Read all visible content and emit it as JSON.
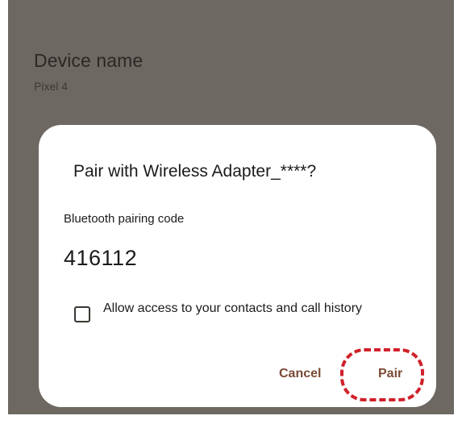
{
  "settings": {
    "device_name_title": "Device name",
    "device_name_value": "Pixel 4"
  },
  "dialog": {
    "title": "Pair with Wireless Adapter_****?",
    "code_label": "Bluetooth pairing code",
    "code_value": "416112",
    "access_checkbox_checked": false,
    "access_label": "Allow access to your contacts and call history",
    "cancel_label": "Cancel",
    "pair_label": "Pair"
  },
  "colors": {
    "scrim": "#6e6862",
    "dialog_bg": "#ffffff",
    "button_text": "#7a4a35",
    "highlight": "#d0202a"
  }
}
